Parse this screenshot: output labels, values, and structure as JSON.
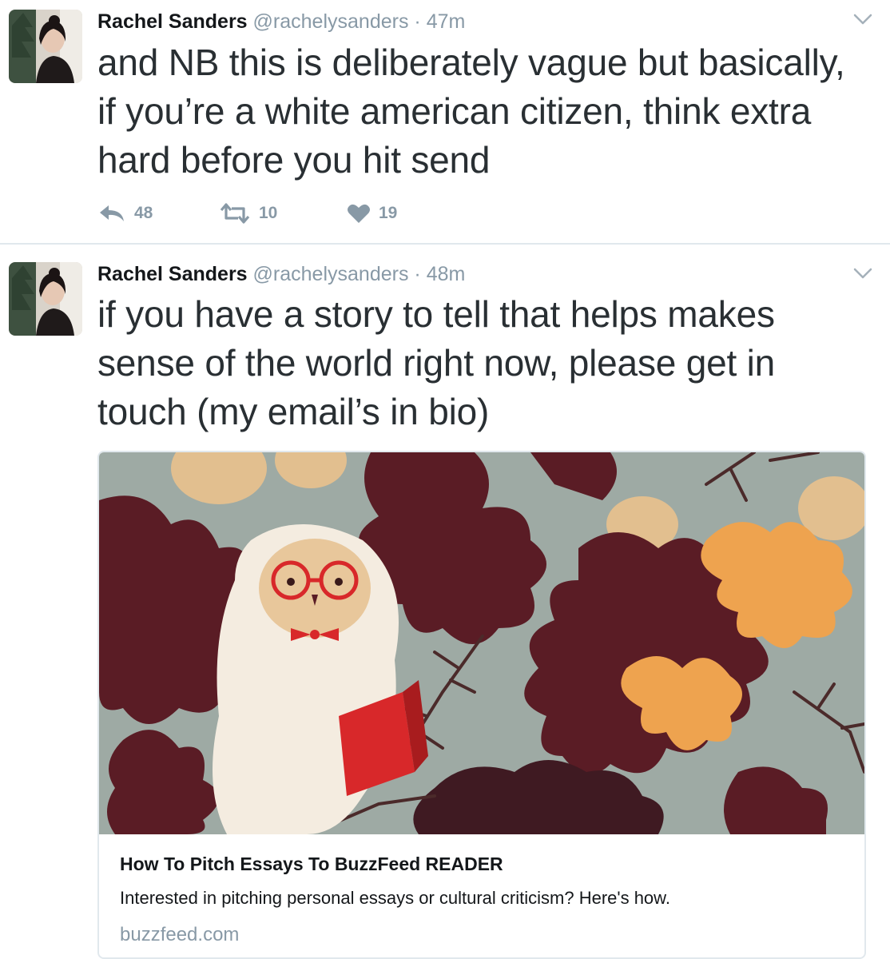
{
  "tweets": [
    {
      "author_name": "Rachel Sanders",
      "handle": "@rachelysanders",
      "separator": "·",
      "time": "47m",
      "text": "and NB this is deliberately vague but basically, if you’re a white american citizen, think extra hard before you hit send",
      "replies": "48",
      "retweets": "10",
      "likes": "19"
    },
    {
      "author_name": "Rachel Sanders",
      "handle": "@rachelysanders",
      "separator": "·",
      "time": "48m",
      "text": "if you have a story to tell that helps makes sense of the world right now, please get in touch (my email’s in bio)",
      "card": {
        "title": "How To Pitch Essays To BuzzFeed READER",
        "description": "Interested in pitching personal essays or cultural criticism? Here's how.",
        "domain": "buzzfeed.com"
      }
    }
  ],
  "colors": {
    "text": "#14171a",
    "secondary": "#8899a6",
    "border": "#e1e8ed",
    "illustration_bg": "#9eaaa4",
    "leaf_dark": "#5a1c25",
    "leaf_orange": "#eea34f",
    "book_red": "#d8282a"
  },
  "icons": [
    "reply-icon",
    "retweet-icon",
    "like-icon",
    "chevron-down-icon"
  ]
}
